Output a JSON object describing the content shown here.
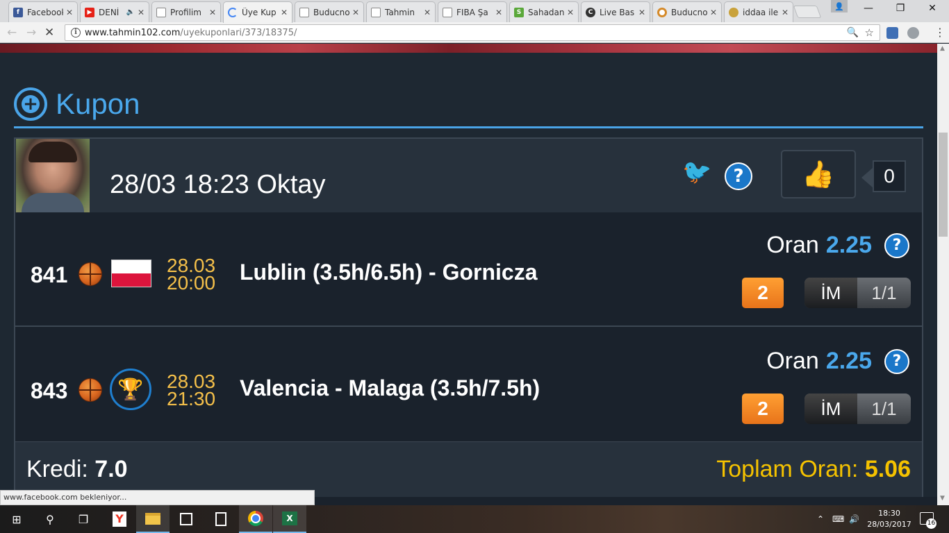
{
  "browser": {
    "tabs": [
      {
        "label": "Facebook",
        "icon": "facebook-icon",
        "favicon_class": "fav-fb",
        "favicon_text": "f",
        "active": false,
        "audio": false
      },
      {
        "label": "DENİ",
        "icon": "youtube-icon",
        "favicon_class": "fav-yt",
        "favicon_text": "▶",
        "active": false,
        "audio": true
      },
      {
        "label": "Profilim",
        "icon": "document-icon",
        "favicon_class": "fav-doc",
        "favicon_text": "",
        "active": false,
        "audio": false
      },
      {
        "label": "Üye Kup",
        "icon": "loading-icon",
        "favicon_class": "fav-load",
        "favicon_text": "",
        "active": true,
        "audio": false
      },
      {
        "label": "Buducno",
        "icon": "document-icon",
        "favicon_class": "fav-doc",
        "favicon_text": "",
        "active": false,
        "audio": false
      },
      {
        "label": "Tahmin",
        "icon": "document-icon",
        "favicon_class": "fav-doc",
        "favicon_text": "",
        "active": false,
        "audio": false
      },
      {
        "label": "FIBA Şa",
        "icon": "document-icon",
        "favicon_class": "fav-doc",
        "favicon_text": "",
        "active": false,
        "audio": false
      },
      {
        "label": "Sahadan",
        "icon": "sahadan-icon",
        "favicon_class": "fav-s",
        "favicon_text": "S",
        "active": false,
        "audio": false
      },
      {
        "label": "Live Bas",
        "icon": "live-icon",
        "favicon_class": "fav-live",
        "favicon_text": "C",
        "active": false,
        "audio": false
      },
      {
        "label": "Buducno",
        "icon": "ring-icon",
        "favicon_class": "fav-ring",
        "favicon_text": "",
        "active": false,
        "audio": false
      },
      {
        "label": "iddaa ile",
        "icon": "coin-icon",
        "favicon_class": "fav-gold",
        "favicon_text": "",
        "active": false,
        "audio": false
      }
    ],
    "url_host": "www.tahmin102.com",
    "url_path": "/uyekuponlari/373/18375/",
    "status_text": "www.facebook.com bekleniyor..."
  },
  "page": {
    "section_title": "Kupon",
    "post": {
      "datetime": "28/03 18:23",
      "author": "Oktay",
      "like_count": "0"
    },
    "matches": [
      {
        "code": "841",
        "date": "28.03",
        "time": "20:00",
        "name": "Lublin (3.5h/6.5h) - Gornicza",
        "odds_label": "Oran",
        "odds": "2.25",
        "pick": "2",
        "bet_type": "İM",
        "bet_value": "1/1",
        "league_icon": "poland-flag-icon"
      },
      {
        "code": "843",
        "date": "28.03",
        "time": "21:30",
        "name": "Valencia - Malaga (3.5h/7.5h)",
        "odds_label": "Oran",
        "odds": "2.25",
        "pick": "2",
        "bet_type": "İM",
        "bet_value": "1/1",
        "league_icon": "euroleague-trophy-icon"
      }
    ],
    "footer": {
      "kredi_label": "Kredi:",
      "kredi_value": "7.0",
      "toplam_label": "Toplam Oran:",
      "toplam_value": "5.06"
    }
  },
  "taskbar": {
    "clock_time": "18:30",
    "clock_date": "28/03/2017",
    "notification_count": "16"
  },
  "colors": {
    "accent_blue": "#4aa8ec",
    "gold": "#f5c200",
    "date_yellow": "#f5c04a",
    "pick_orange": "#e8741a",
    "page_bg": "#1e2832"
  }
}
